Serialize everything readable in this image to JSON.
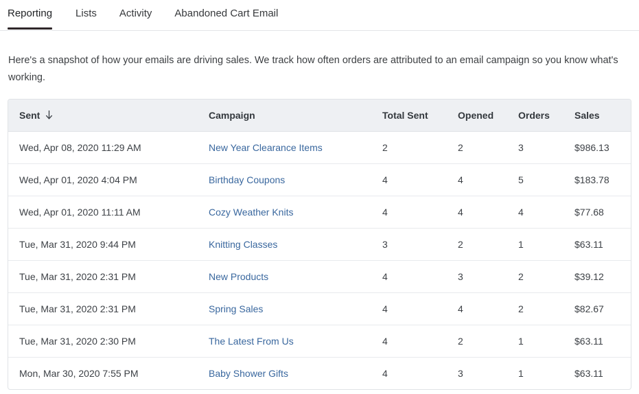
{
  "tabs": [
    {
      "label": "Reporting",
      "active": true
    },
    {
      "label": "Lists",
      "active": false
    },
    {
      "label": "Activity",
      "active": false
    },
    {
      "label": "Abandoned Cart Email",
      "active": false
    }
  ],
  "intro": {
    "text": "Here's a snapshot of how your emails are driving sales. We track how often orders are attributed to an email campaign so you know what's working."
  },
  "table": {
    "sort": {
      "column": "Sent",
      "direction": "descending",
      "icon": "arrow-down-icon"
    },
    "columns": [
      {
        "key": "sent",
        "label": "Sent"
      },
      {
        "key": "campaign",
        "label": "Campaign"
      },
      {
        "key": "total_sent",
        "label": "Total Sent"
      },
      {
        "key": "opened",
        "label": "Opened"
      },
      {
        "key": "orders",
        "label": "Orders"
      },
      {
        "key": "sales",
        "label": "Sales"
      }
    ],
    "rows": [
      {
        "sent": "Wed, Apr 08, 2020 11:29 AM",
        "campaign": "New Year Clearance Items",
        "total_sent": "2",
        "opened": "2",
        "orders": "3",
        "sales": "$986.13"
      },
      {
        "sent": "Wed, Apr 01, 2020 4:04 PM",
        "campaign": "Birthday Coupons",
        "total_sent": "4",
        "opened": "4",
        "orders": "5",
        "sales": "$183.78"
      },
      {
        "sent": "Wed, Apr 01, 2020 11:11 AM",
        "campaign": "Cozy Weather Knits",
        "total_sent": "4",
        "opened": "4",
        "orders": "4",
        "sales": "$77.68"
      },
      {
        "sent": "Tue, Mar 31, 2020 9:44 PM",
        "campaign": "Knitting Classes",
        "total_sent": "3",
        "opened": "2",
        "orders": "1",
        "sales": "$63.11"
      },
      {
        "sent": "Tue, Mar 31, 2020 2:31 PM",
        "campaign": "New Products",
        "total_sent": "4",
        "opened": "3",
        "orders": "2",
        "sales": "$39.12"
      },
      {
        "sent": "Tue, Mar 31, 2020 2:31 PM",
        "campaign": "Spring Sales",
        "total_sent": "4",
        "opened": "4",
        "orders": "2",
        "sales": "$82.67"
      },
      {
        "sent": "Tue, Mar 31, 2020 2:30 PM",
        "campaign": "The Latest From Us",
        "total_sent": "4",
        "opened": "2",
        "orders": "1",
        "sales": "$63.11"
      },
      {
        "sent": "Mon, Mar 30, 2020 7:55 PM",
        "campaign": "Baby Shower Gifts",
        "total_sent": "4",
        "opened": "3",
        "orders": "1",
        "sales": "$63.11"
      }
    ]
  },
  "colors": {
    "link": "#39679e",
    "active_tab_underline": "#2f2729",
    "header_background": "#eef0f3",
    "border": "#e0e3e6",
    "text": "#3d4146"
  }
}
